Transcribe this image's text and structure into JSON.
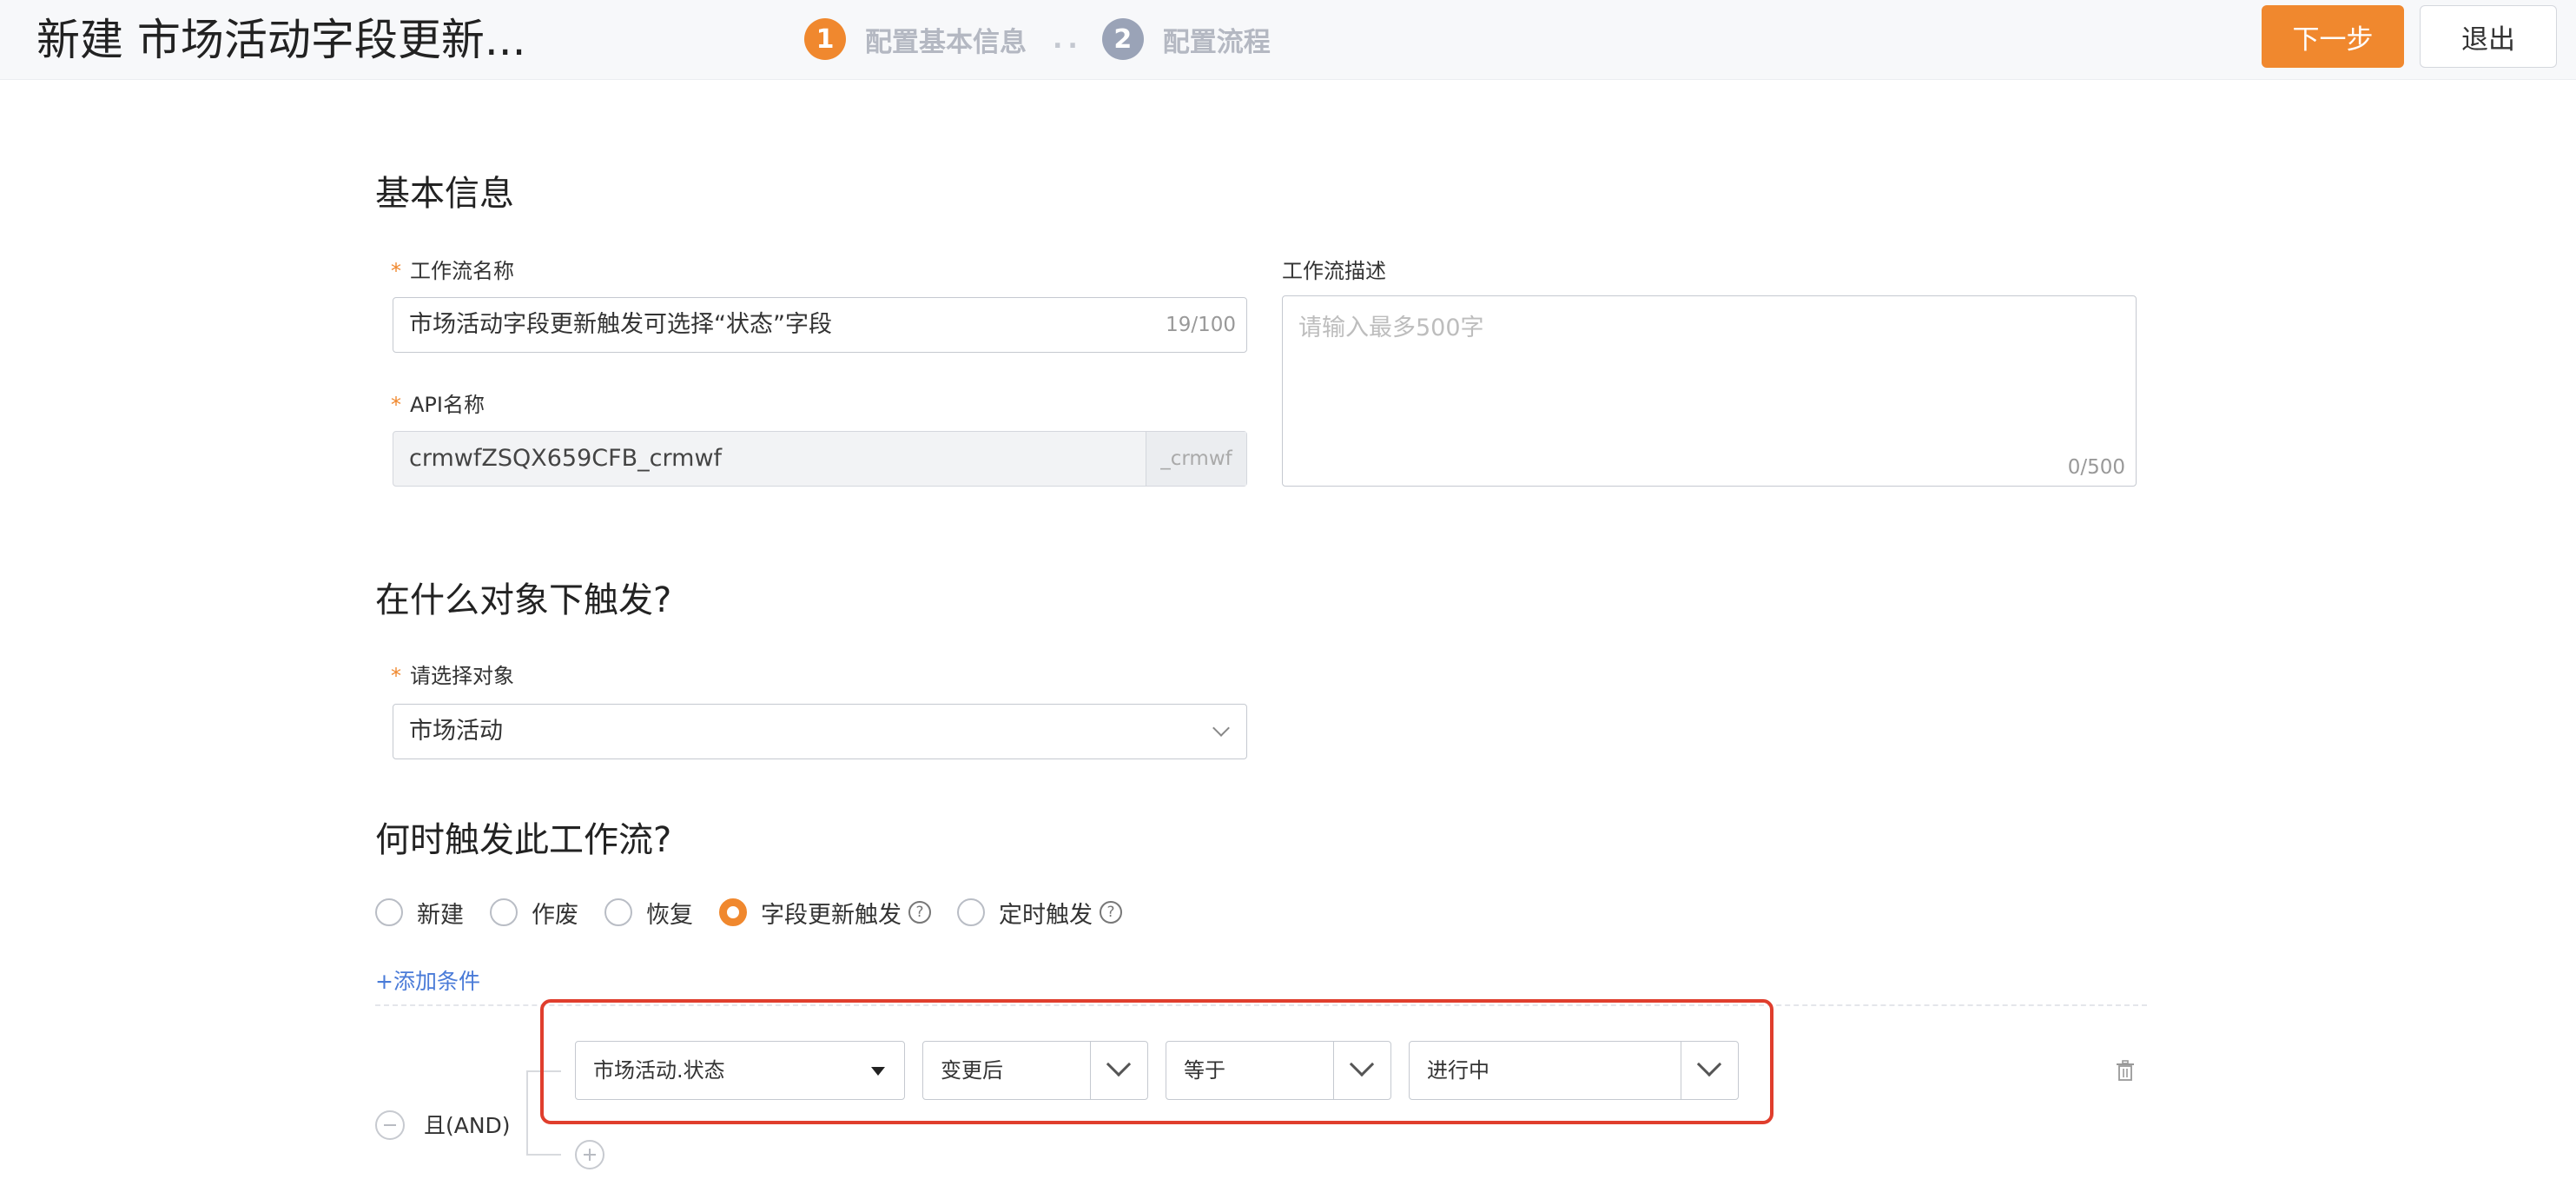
{
  "header": {
    "title": "新建 市场活动字段更新...",
    "steps": [
      {
        "number": "1",
        "label": "配置基本信息"
      },
      {
        "number": "2",
        "label": "配置流程"
      }
    ],
    "step_separator": "..",
    "next_label": "下一步",
    "exit_label": "退出"
  },
  "basic_info": {
    "heading": "基本信息",
    "workflow_name": {
      "required_mark": "*",
      "label": "工作流名称",
      "value": "市场活动字段更新触发可选择“状态”字段",
      "count": "19/100"
    },
    "api_name": {
      "required_mark": "*",
      "label": "API名称",
      "value": "crmwfZSQX659CFB_crmwf",
      "suffix": "_crmwf"
    },
    "description": {
      "label": "工作流描述",
      "placeholder": "请输入最多500字",
      "count": "0/500"
    }
  },
  "trigger_object": {
    "heading": "在什么对象下触发?",
    "required_mark": "*",
    "label": "请选择对象",
    "value": "市场活动"
  },
  "trigger_when": {
    "heading": "何时触发此工作流?",
    "options": [
      {
        "label": "新建",
        "checked": false,
        "help": false
      },
      {
        "label": "作废",
        "checked": false,
        "help": false
      },
      {
        "label": "恢复",
        "checked": false,
        "help": false
      },
      {
        "label": "字段更新触发",
        "checked": true,
        "help": true
      },
      {
        "label": "定时触发",
        "checked": false,
        "help": true
      }
    ],
    "help_glyph": "?",
    "add_condition": "+添加条件",
    "logic_label": "且(AND)",
    "condition": {
      "field": "市场活动.状态",
      "timing": "变更后",
      "operator": "等于",
      "value": "进行中"
    }
  },
  "colors": {
    "accent": "#f0882e",
    "highlight_border": "#e03e2d",
    "link": "#4a7bd8",
    "step_inactive": "#9aa3b7"
  },
  "icons": [
    "chevron-down-icon",
    "caret-down-icon",
    "question-circle-icon",
    "minus-circle-icon",
    "plus-circle-icon",
    "trash-icon"
  ]
}
